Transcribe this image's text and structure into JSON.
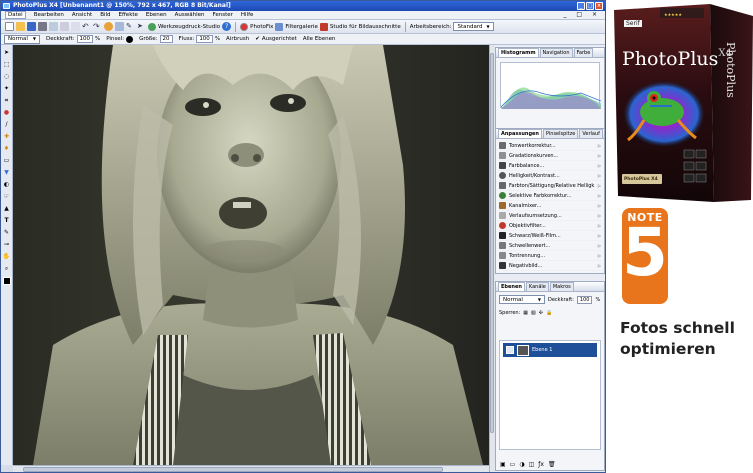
{
  "window": {
    "title": "PhotoPlus X4  [Unbenannt1 @ 150%, 792 x 467, RGB 8 Bit/Kanal]",
    "buttons": [
      "_",
      "□",
      "×"
    ],
    "doc_buttons": "_ □ ×"
  },
  "menu": [
    "Datei",
    "Bearbeiten",
    "Ansicht",
    "Bild",
    "Effekte",
    "Ebenen",
    "Auswählen",
    "Fenster",
    "Hilfe"
  ],
  "toolbar1": {
    "print_studio": "Werkzeugdruck-Studio",
    "photofix": "PhotoFix",
    "filter_gallery": "Filtergalerie",
    "image_cutout": "Studio für Bildausschnitte",
    "workspace_label": "Arbeitsbereich:",
    "workspace_value": "Standard"
  },
  "toolbar2": {
    "mode": "Normal",
    "opacity_label": "Deckkraft:",
    "opacity_value": "100",
    "opacity_unit": "%",
    "brush_label": "Pinsel:",
    "size_label": "Größe:",
    "size_value": "20",
    "flow_label": "Fluss:",
    "flow_value": "100",
    "flow_unit": "%",
    "airbrush": "Airbrush",
    "aligned": "Ausgerichtet",
    "all_layers": "Alle Ebenen"
  },
  "histogram_panel": {
    "tabs": [
      "Histogramm",
      "Navigation",
      "Farbe"
    ]
  },
  "adjustments_panel": {
    "tabs": [
      "Anpassungen",
      "Pinselspitze",
      "Verlauf"
    ],
    "items": [
      {
        "label": "Tonwertkorrektur...",
        "icon": "levels-icon",
        "color": "#6b6b6b"
      },
      {
        "label": "Gradationskurven...",
        "icon": "curves-icon",
        "color": "#8f8f8f"
      },
      {
        "label": "Farbbalance...",
        "icon": "color-balance-icon",
        "color": "#444444"
      },
      {
        "label": "Helligkeit/Kontrast...",
        "icon": "brightness-icon",
        "color": "#555555"
      },
      {
        "label": "Farbton/Sättigung/Relative Helligk...",
        "icon": "hue-saturation-icon",
        "color": "#666666"
      },
      {
        "label": "Selektive Farbkorrektur...",
        "icon": "selective-color-icon",
        "color": "#3a7f3a"
      },
      {
        "label": "Kanalmixer...",
        "icon": "channel-mixer-icon",
        "color": "#9c6a2a"
      },
      {
        "label": "Verlaufsumsetzung...",
        "icon": "gradient-map-icon",
        "color": "#aaaaaa"
      },
      {
        "label": "Objektivfilter...",
        "icon": "lens-filter-icon",
        "color": "#c0392b"
      },
      {
        "label": "Schwarz/Weiß-Film...",
        "icon": "bw-film-icon",
        "color": "#222222"
      },
      {
        "label": "Schwellenwert...",
        "icon": "threshold-icon",
        "color": "#777777"
      },
      {
        "label": "Tontrennung...",
        "icon": "posterize-icon",
        "color": "#888888"
      },
      {
        "label": "Negativbild...",
        "icon": "invert-icon",
        "color": "#333333"
      }
    ]
  },
  "layers_panel": {
    "tabs": [
      "Ebenen",
      "Kanäle",
      "Makros"
    ],
    "blend_mode": "Normal",
    "opacity_label": "Deckkraft:",
    "opacity_value": "100",
    "opacity_unit": "%",
    "lock_label": "Sperren:",
    "layer_name": "Ebene 1"
  },
  "product": {
    "brand": "Serif",
    "name": "PhotoPlus",
    "version": "X4",
    "spine": "PhotoPlus",
    "edition": "PhotoPlus X4"
  },
  "note": {
    "label": "NOTE",
    "value": "5",
    "color": "#e8741b"
  },
  "caption": {
    "line1": "Fotos schnell",
    "line2": "optimieren"
  }
}
